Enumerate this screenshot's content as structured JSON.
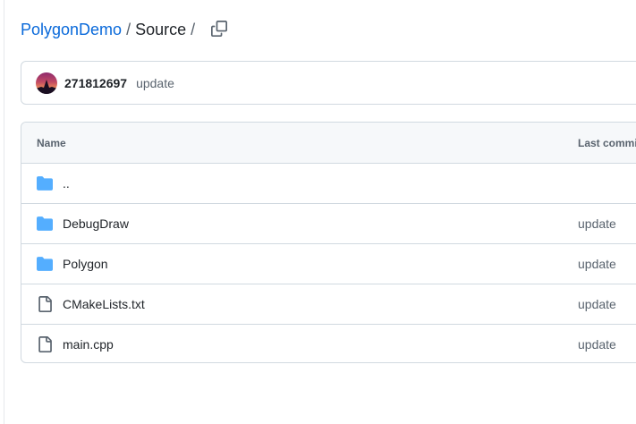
{
  "breadcrumb": {
    "repo": "PolygonDemo",
    "separator": "/",
    "current": "Source",
    "trailing_separator": "/"
  },
  "copy_button": {
    "icon": "copy-icon"
  },
  "latest_commit": {
    "author": "271812697",
    "message": "update"
  },
  "file_table": {
    "headers": {
      "name": "Name",
      "last_commit": "Last commit message"
    },
    "rows": [
      {
        "type": "folder",
        "icon": "folder-icon",
        "name": "..",
        "commit": ""
      },
      {
        "type": "folder",
        "icon": "folder-icon",
        "name": "DebugDraw",
        "commit": "update"
      },
      {
        "type": "folder",
        "icon": "folder-icon",
        "name": "Polygon",
        "commit": "update"
      },
      {
        "type": "file",
        "icon": "file-icon",
        "name": "CMakeLists.txt",
        "commit": "update"
      },
      {
        "type": "file",
        "icon": "file-icon",
        "name": "main.cpp",
        "commit": "update"
      }
    ]
  },
  "colors": {
    "link": "#0969da",
    "folder": "#54aeff",
    "file_icon": "#59636e",
    "border": "#d1d9e0",
    "header_bg": "#f6f8fa"
  }
}
